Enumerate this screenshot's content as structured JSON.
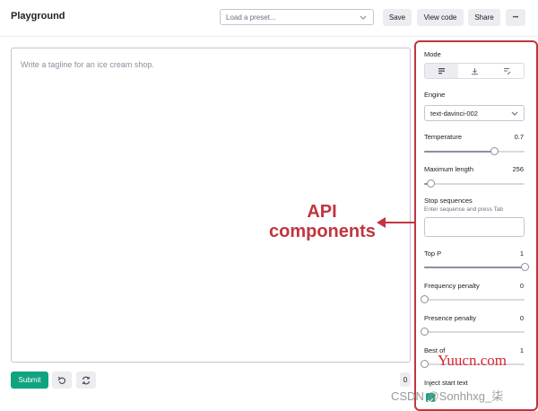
{
  "header": {
    "title": "Playground",
    "preset_placeholder": "Load a preset...",
    "save_label": "Save",
    "view_code_label": "View code",
    "share_label": "Share",
    "more_label": "•••"
  },
  "editor": {
    "placeholder": "Write a tagline for an ice cream shop."
  },
  "footer": {
    "submit_label": "Submit",
    "token_count": "0"
  },
  "settings": {
    "mode_label": "Mode",
    "engine_label": "Engine",
    "engine_value": "text-davinci-002",
    "temperature": {
      "label": "Temperature",
      "value": "0.7",
      "fraction": 0.7
    },
    "max_length": {
      "label": "Maximum length",
      "value": "256",
      "fraction": 0.06
    },
    "stop_sequences": {
      "label": "Stop sequences",
      "hint": "Enter sequence and press Tab"
    },
    "top_p": {
      "label": "Top P",
      "value": "1",
      "fraction": 1.0
    },
    "frequency_penalty": {
      "label": "Frequency penalty",
      "value": "0",
      "fraction": 0.0
    },
    "presence_penalty": {
      "label": "Presence penalty",
      "value": "0",
      "fraction": 0.0
    },
    "best_of": {
      "label": "Best of",
      "value": "1",
      "fraction": 0.0
    },
    "inject_start_label": "Inject start text"
  },
  "annotation": {
    "line1": "API",
    "line2": "components",
    "color": "#c13540"
  },
  "watermarks": {
    "site": "Yuucn.com",
    "csdn": "CSDN @Sonhhxg_柒"
  },
  "colors": {
    "accent_green": "#10a37f",
    "button_grey": "#ececf1"
  }
}
